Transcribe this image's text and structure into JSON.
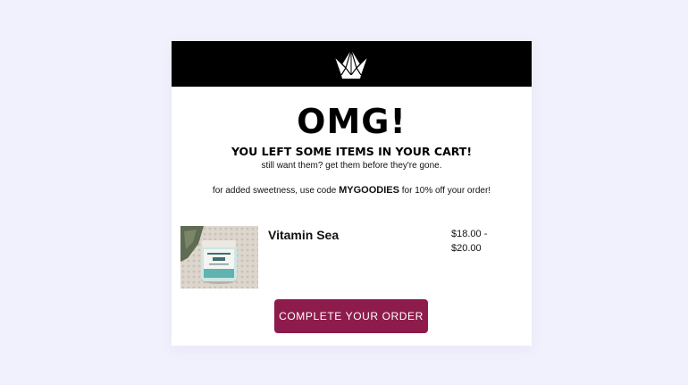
{
  "email": {
    "brand": {
      "logo_icon": "crown-icon",
      "header_color": "#000000"
    },
    "headline": "OMG!",
    "subheadline": "YOU LEFT SOME ITEMS IN YOUR CART!",
    "tagline": "still want them? get them before they're gone.",
    "promo": {
      "text_before": "for added sweetness, use code ",
      "code": "MYGOODIES",
      "text_after": " for 10% off your order!"
    },
    "cart_item": {
      "name": "Vitamin Sea",
      "price_line1": "$18.00 -",
      "price_line2": "$20.00"
    },
    "cta": {
      "label": "COMPLETE YOUR ORDER",
      "color": "#8d1c4c"
    }
  }
}
